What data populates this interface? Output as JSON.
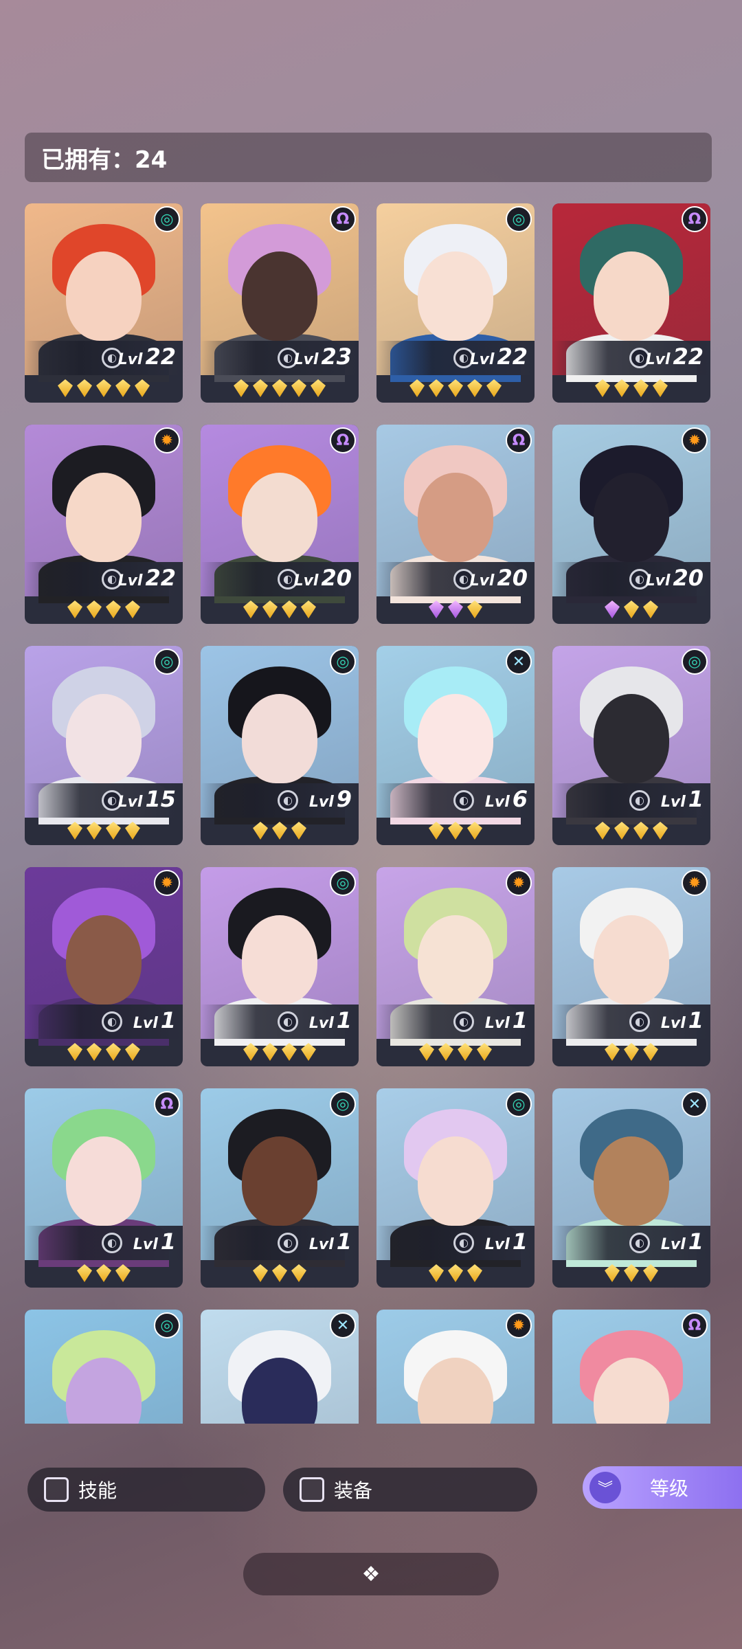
{
  "header": {
    "owned_label": "已拥有：24"
  },
  "level_label": "Lvl",
  "cards": [
    {
      "level": "22",
      "element": "wind",
      "element_icon": "wind-element-icon",
      "stars": 5,
      "purple": 0,
      "bg": "#f0b88a",
      "hair": "#e0462a",
      "skin": "#f6d2c0",
      "outfit": "#2d2f3a"
    },
    {
      "level": "23",
      "element": "dark",
      "element_icon": "dark-element-icon",
      "stars": 5,
      "purple": 0,
      "bg": "#f3c38c",
      "hair": "#d39bd8",
      "skin": "#4a3430",
      "outfit": "#4b4d58"
    },
    {
      "level": "22",
      "element": "wind",
      "element_icon": "wind-element-icon",
      "stars": 5,
      "purple": 0,
      "bg": "#f5cf9e",
      "hair": "#eef0f6",
      "skin": "#f8e0d4",
      "outfit": "#2e5fa8"
    },
    {
      "level": "22",
      "element": "dark",
      "element_icon": "dark-element-icon",
      "stars": 4,
      "purple": 0,
      "bg": "#b8283a",
      "hair": "#2f6a64",
      "skin": "#f6d8c8",
      "outfit": "#f0f0f0"
    },
    {
      "level": "22",
      "element": "fire",
      "element_icon": "fire-element-icon",
      "stars": 4,
      "purple": 0,
      "bg": "#b48ad8",
      "hair": "#1c1c22",
      "skin": "#f6d8c8",
      "outfit": "#222226"
    },
    {
      "level": "20",
      "element": "dark",
      "element_icon": "dark-element-icon",
      "stars": 4,
      "purple": 0,
      "bg": "#b58ae0",
      "hair": "#ff7a2a",
      "skin": "#f3dcd0",
      "outfit": "#3f4a3c"
    },
    {
      "level": "20",
      "element": "dark",
      "element_icon": "dark-element-icon",
      "stars": 3,
      "purple": 2,
      "bg": "#a7c9e4",
      "hair": "#f0c8c2",
      "skin": "#d59c84",
      "outfit": "#f3e4dc"
    },
    {
      "level": "20",
      "element": "fire",
      "element_icon": "fire-element-icon",
      "stars": 3,
      "purple": 1,
      "bg": "#a6cbe2",
      "hair": "#1c1b2c",
      "skin": "#22202e",
      "outfit": "#2a2838"
    },
    {
      "level": "15",
      "element": "wind",
      "element_icon": "wind-element-icon",
      "stars": 4,
      "purple": 0,
      "bg": "#b9a2e8",
      "hair": "#cfd2e6",
      "skin": "#f2e2e4",
      "outfit": "#e8e8ee"
    },
    {
      "level": "9",
      "element": "wind",
      "element_icon": "wind-element-icon",
      "stars": 3,
      "purple": 0,
      "bg": "#9cc4e6",
      "hair": "#16161c",
      "skin": "#f2dcd8",
      "outfit": "#222228"
    },
    {
      "level": "6",
      "element": "ice",
      "element_icon": "ice-element-icon",
      "stars": 3,
      "purple": 0,
      "bg": "#a3cfe8",
      "hair": "#a8ecf6",
      "skin": "#fbe6e4",
      "outfit": "#f2d8e4"
    },
    {
      "level": "1",
      "element": "wind",
      "element_icon": "wind-element-icon",
      "stars": 4,
      "purple": 0,
      "bg": "#c4a4e8",
      "hair": "#e6e6ea",
      "skin": "#2c2b32",
      "outfit": "#3a3840"
    },
    {
      "level": "1",
      "element": "fire",
      "element_icon": "fire-element-icon",
      "stars": 4,
      "purple": 0,
      "bg": "#6c3a9a",
      "hair": "#a05ad8",
      "skin": "#8a5a48",
      "outfit": "#4a2f6a"
    },
    {
      "level": "1",
      "element": "wind",
      "element_icon": "wind-element-icon",
      "stars": 4,
      "purple": 0,
      "bg": "#c49ce8",
      "hair": "#1a1a20",
      "skin": "#f6ddd6",
      "outfit": "#f0f0f2"
    },
    {
      "level": "1",
      "element": "fire",
      "element_icon": "fire-element-icon",
      "stars": 4,
      "purple": 0,
      "bg": "#c7a4e8",
      "hair": "#cfe0a0",
      "skin": "#f6e2d4",
      "outfit": "#e8e6e0"
    },
    {
      "level": "1",
      "element": "fire",
      "element_icon": "fire-element-icon",
      "stars": 3,
      "purple": 0,
      "bg": "#a8cae6",
      "hair": "#f2f2f2",
      "skin": "#f6dcd0",
      "outfit": "#ececee"
    },
    {
      "level": "1",
      "element": "dark",
      "element_icon": "dark-element-icon",
      "stars": 3,
      "purple": 0,
      "bg": "#9ccbe8",
      "hair": "#8ad88c",
      "skin": "#f6dcd8",
      "outfit": "#6a3c7a"
    },
    {
      "level": "1",
      "element": "wind",
      "element_icon": "wind-element-icon",
      "stars": 3,
      "purple": 0,
      "bg": "#9ccbe8",
      "hair": "#1c1c22",
      "skin": "#6a4030",
      "outfit": "#2e2c34"
    },
    {
      "level": "1",
      "element": "wind",
      "element_icon": "wind-element-icon",
      "stars": 3,
      "purple": 0,
      "bg": "#a8cde8",
      "hair": "#e2c8f0",
      "skin": "#f6dcd0",
      "outfit": "#222228"
    },
    {
      "level": "1",
      "element": "ice",
      "element_icon": "ice-element-icon",
      "stars": 3,
      "purple": 0,
      "bg": "#a4c8e4",
      "hair": "#3f6a88",
      "skin": "#b2825c",
      "outfit": "#bfe8d8"
    },
    {
      "level": "",
      "element": "wind",
      "element_icon": "wind-element-icon",
      "stars": 0,
      "purple": 0,
      "bg": "#8cc4e6",
      "hair": "#c9e89a",
      "skin": "#c4a4e0",
      "outfit": "#2c2a38"
    },
    {
      "level": "",
      "element": "ice",
      "element_icon": "ice-element-icon",
      "stars": 0,
      "purple": 0,
      "bg": "#c0dcee",
      "hair": "#f0f2f6",
      "skin": "#2a2c5a",
      "outfit": "#e4e6ee"
    },
    {
      "level": "",
      "element": "fire",
      "element_icon": "fire-element-icon",
      "stars": 0,
      "purple": 0,
      "bg": "#9ccbe8",
      "hair": "#f6f6f6",
      "skin": "#f0d2c0",
      "outfit": "#eaeaea"
    },
    {
      "level": "",
      "element": "dark",
      "element_icon": "dark-element-icon",
      "stars": 0,
      "purple": 0,
      "bg": "#9ccbe8",
      "hair": "#f08aa0",
      "skin": "#f6dcd0",
      "outfit": "#e0e0e0"
    }
  ],
  "element_glyphs": {
    "wind": "◎",
    "dark": "Ω",
    "fire": "✹",
    "ice": "✕"
  },
  "filters": {
    "skills_label": "技能",
    "equipment_label": "装备"
  },
  "sort": {
    "label": "等级",
    "icon": "chevron-double-down-icon",
    "glyph": "︾"
  },
  "bottom_handle": {
    "icon": "diamond-cluster-icon",
    "glyph": "❖"
  },
  "colors": {
    "accent": "#9a7ff2",
    "gem_gold": "#f2c23a",
    "gem_purple": "#c27ae8"
  }
}
